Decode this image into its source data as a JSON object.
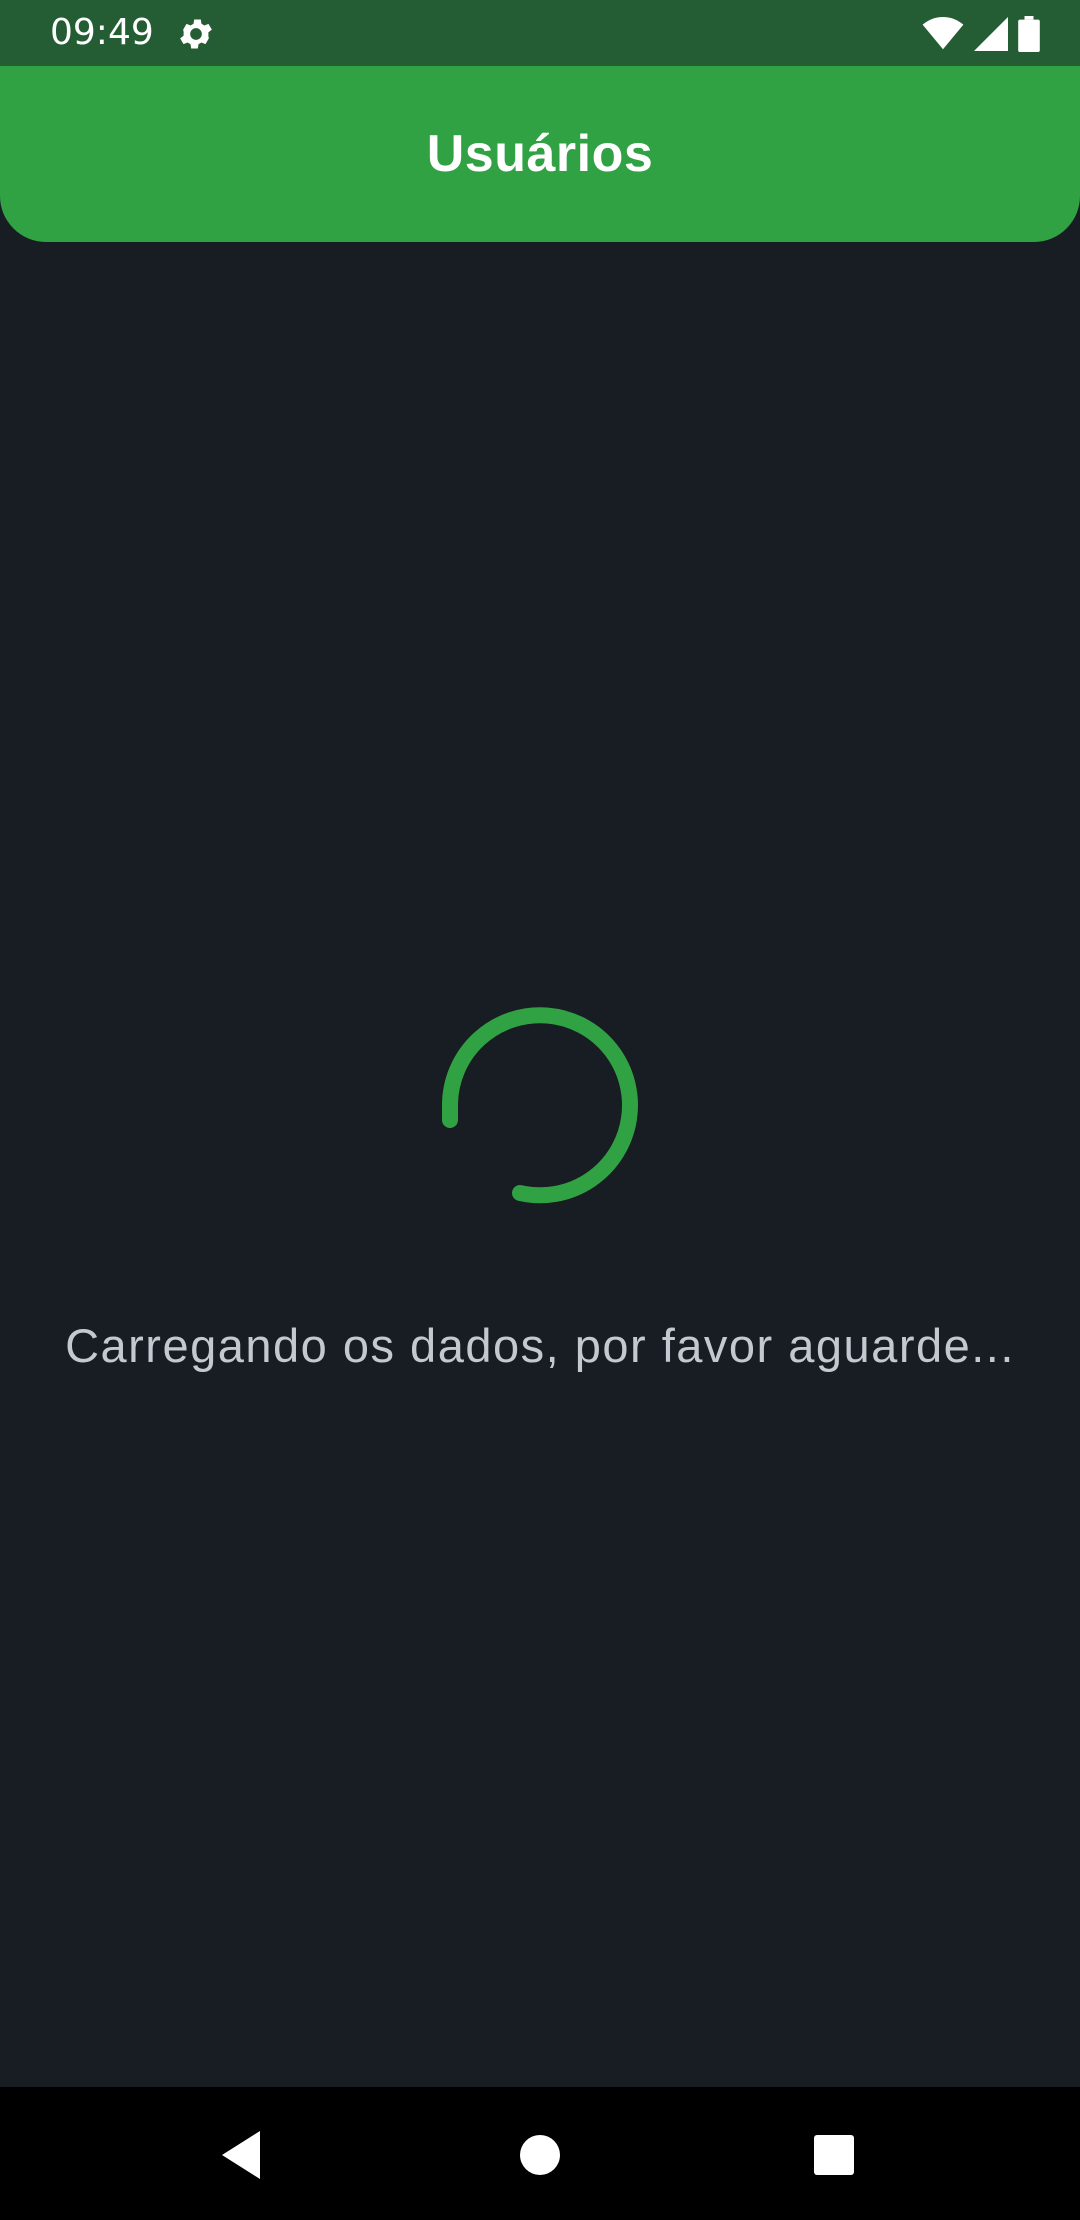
{
  "status_bar": {
    "time": "09:49",
    "icons": [
      "gear-icon",
      "wifi-icon",
      "cell-signal-icon",
      "battery-icon"
    ]
  },
  "app_bar": {
    "title": "Usuários"
  },
  "loading": {
    "message": "Carregando os dados, por favor aguarde..."
  },
  "nav_bar": {
    "icons": [
      "back-icon",
      "home-icon",
      "recents-icon"
    ]
  },
  "colors": {
    "background": "#181c23",
    "status_bar": "#245c34",
    "app_bar": "#30a244",
    "spinner": "#30a244",
    "text": "#c4c8cf"
  }
}
